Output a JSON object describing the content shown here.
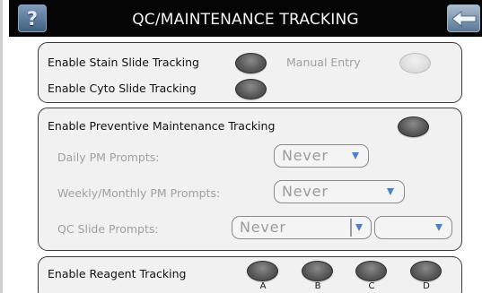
{
  "header": {
    "title": "QC/MAINTENANCE TRACKING",
    "help_glyph": "?",
    "help_icon": "help-icon",
    "back_icon": "back-arrow-icon"
  },
  "slide_tracking": {
    "stain_label": "Enable Stain Slide Tracking",
    "manual_entry_label": "Manual Entry",
    "cyto_label": "Enable Cyto Slide Tracking"
  },
  "preventive_maintenance": {
    "label": "Enable Preventive Maintenance Tracking",
    "daily": {
      "label": "Daily PM Prompts:",
      "value": "Never"
    },
    "weekly_monthly": {
      "label": "Weekly/Monthly PM Prompts:",
      "value": "Never"
    },
    "qc_slide": {
      "label": "QC Slide Prompts:",
      "value": "Never",
      "second_value": ""
    }
  },
  "reagent_tracking": {
    "label": "Enable Reagent Tracking",
    "toggles": [
      "A",
      "B",
      "C",
      "D"
    ]
  },
  "colors": {
    "header_bg": "#050505",
    "panel_bg": "#f1f1f1",
    "dropdown_arrow": "#4a7fd0",
    "disabled_text": "#a0a0a0"
  }
}
